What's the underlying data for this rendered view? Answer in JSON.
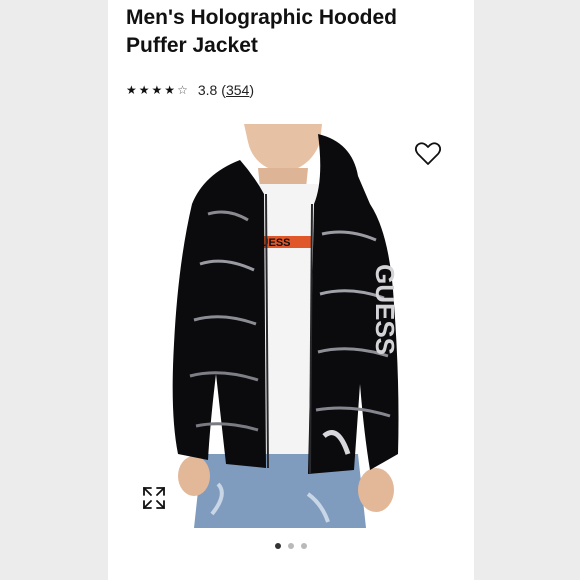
{
  "product": {
    "title": "Men's Holographic Hooded Puffer Jacket",
    "rating": {
      "stars": 3.8,
      "score_text": "3.8",
      "open_paren": "(",
      "review_count": "354",
      "close_paren": ")"
    }
  },
  "gallery": {
    "slide_count": 3,
    "active_slide": 1,
    "favorite_icon": "heart-outline-icon",
    "zoom_icon": "expand-arrows-icon",
    "sleeve_text": "GUESS",
    "shirt_text": "GUESS"
  },
  "colors": {
    "page_background": "#ececec",
    "card_background": "#ffffff",
    "jacket": "#0b0b0d",
    "shirt_stripe": "#e0572a",
    "dot_active": "#333333",
    "dot_inactive": "#b9b9b9"
  }
}
